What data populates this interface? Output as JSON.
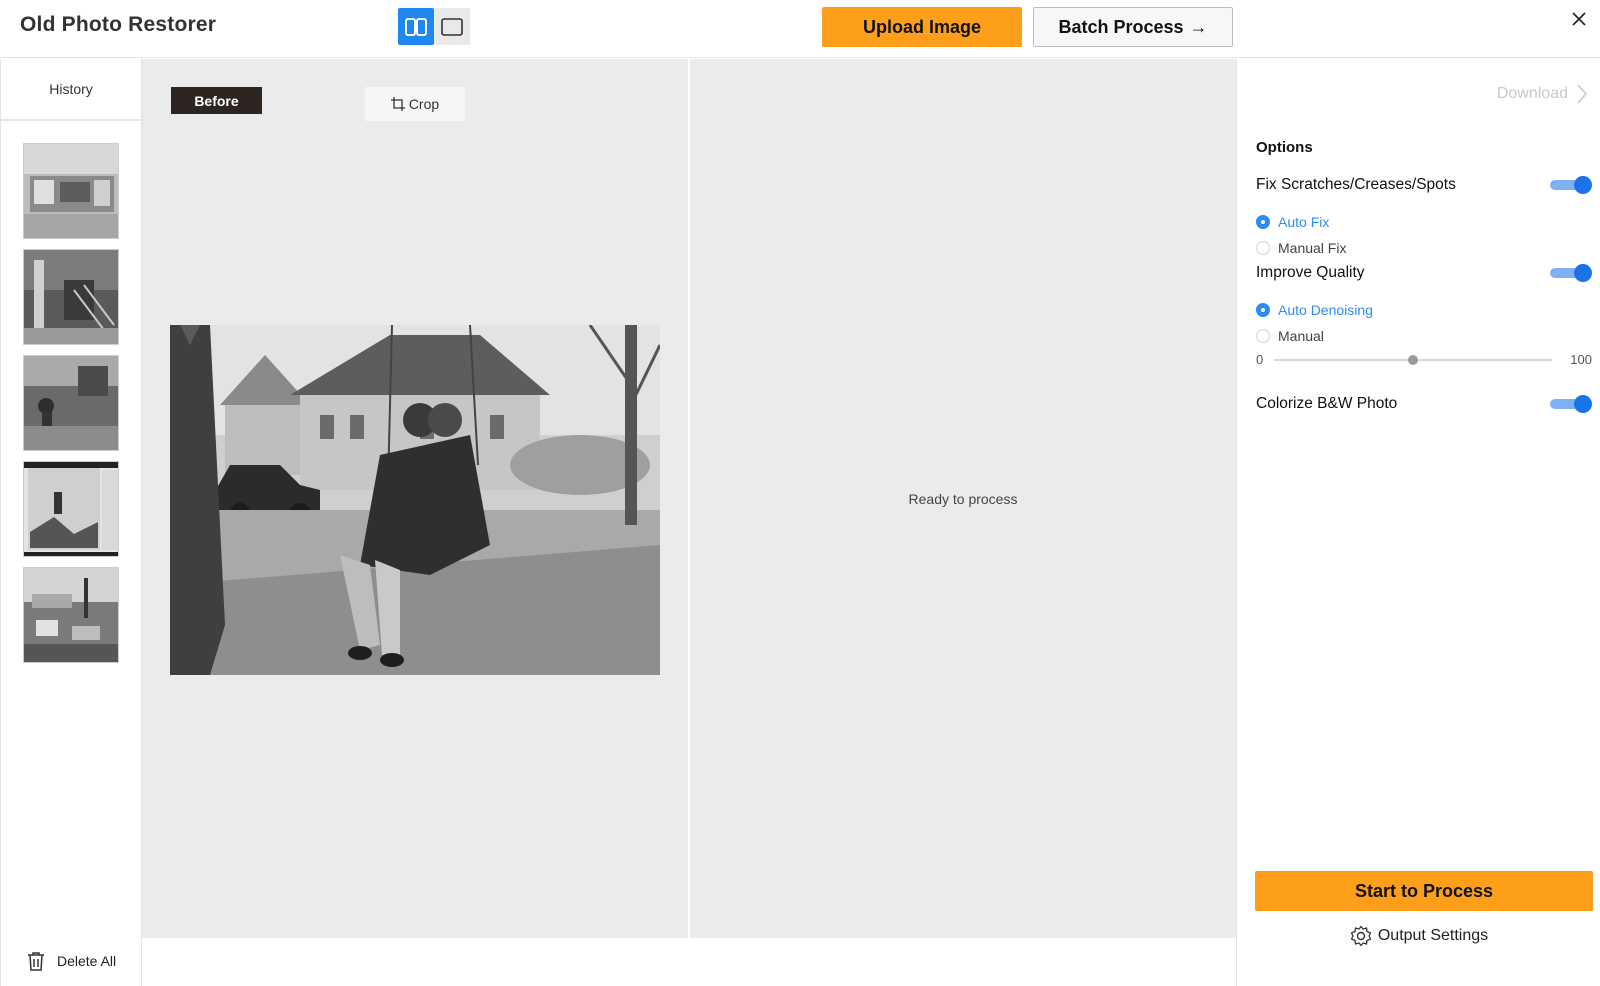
{
  "app": {
    "title": "Old Photo Restorer"
  },
  "header": {
    "upload_label": "Upload Image",
    "batch_label": "Batch Process",
    "batch_arrow": "→"
  },
  "history": {
    "tab_label": "History",
    "delete_all_label": "Delete All",
    "thumbnails": [
      "thumbnail-1",
      "thumbnail-2",
      "thumbnail-3",
      "thumbnail-4",
      "thumbnail-5"
    ]
  },
  "before_pane": {
    "badge": "Before",
    "crop_label": "Crop"
  },
  "after_pane": {
    "status": "Ready to process"
  },
  "options": {
    "download_label": "Download",
    "title": "Options",
    "fix_scratches": {
      "label": "Fix Scratches/Creases/Spots",
      "enabled": true,
      "choices": [
        "Auto Fix",
        "Manual Fix"
      ],
      "selected": "Auto Fix"
    },
    "improve_quality": {
      "label": "Improve Quality",
      "enabled": true,
      "choices": [
        "Auto Denoising",
        "Manual"
      ],
      "selected": "Auto Denoising",
      "slider_min": "0",
      "slider_max": "100",
      "slider_value": 50
    },
    "colorize": {
      "label": "Colorize B&W Photo",
      "enabled": true
    },
    "start_label": "Start to Process",
    "output_settings_label": "Output Settings"
  },
  "colors": {
    "accent_orange": "#fd9f1b",
    "accent_blue": "#1a73e8",
    "selected_blue": "#2d8cf0",
    "canvas_gray": "#ebebeb"
  },
  "icons": [
    "split-view-icon",
    "single-view-icon",
    "close-icon",
    "arrow-right-icon",
    "crop-icon",
    "trash-icon",
    "chevron-right-icon",
    "gear-icon"
  ]
}
